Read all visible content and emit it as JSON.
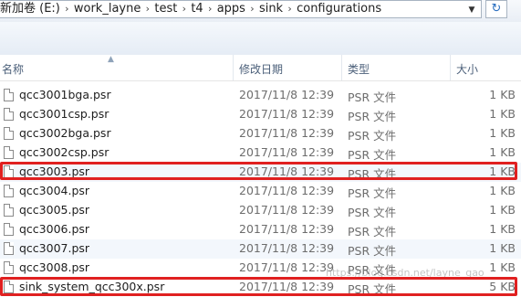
{
  "address": {
    "crumbs": [
      "新加卷 (E:)",
      "work_layne",
      "test",
      "t4",
      "apps",
      "sink",
      "configurations"
    ],
    "refresh_icon": "refresh-icon"
  },
  "columns": {
    "name": "名称",
    "modified": "修改日期",
    "type": "类型",
    "size": "大小"
  },
  "files": [
    {
      "name": "qcc3001bga.psr",
      "modified": "2017/11/8 12:39",
      "type": "PSR 文件",
      "size": "1 KB"
    },
    {
      "name": "qcc3001csp.psr",
      "modified": "2017/11/8 12:39",
      "type": "PSR 文件",
      "size": "1 KB"
    },
    {
      "name": "qcc3002bga.psr",
      "modified": "2017/11/8 12:39",
      "type": "PSR 文件",
      "size": "1 KB"
    },
    {
      "name": "qcc3002csp.psr",
      "modified": "2017/11/8 12:39",
      "type": "PSR 文件",
      "size": "1 KB"
    },
    {
      "name": "qcc3003.psr",
      "modified": "2017/11/8 12:39",
      "type": "PSR 文件",
      "size": "1 KB"
    },
    {
      "name": "qcc3004.psr",
      "modified": "2017/11/8 12:39",
      "type": "PSR 文件",
      "size": "1 KB"
    },
    {
      "name": "qcc3005.psr",
      "modified": "2017/11/8 12:39",
      "type": "PSR 文件",
      "size": "1 KB"
    },
    {
      "name": "qcc3006.psr",
      "modified": "2017/11/8 12:39",
      "type": "PSR 文件",
      "size": "1 KB"
    },
    {
      "name": "qcc3007.psr",
      "modified": "2017/11/8 12:39",
      "type": "PSR 文件",
      "size": "1 KB"
    },
    {
      "name": "qcc3008.psr",
      "modified": "2017/11/8 12:39",
      "type": "PSR 文件",
      "size": "1 KB"
    },
    {
      "name": "sink_system_qcc300x.psr",
      "modified": "2017/11/8 12:39",
      "type": "PSR 文件",
      "size": "5 KB"
    }
  ],
  "annotation_color": "#e02020",
  "watermark": "https://blog.csdn.net/layne_gao"
}
